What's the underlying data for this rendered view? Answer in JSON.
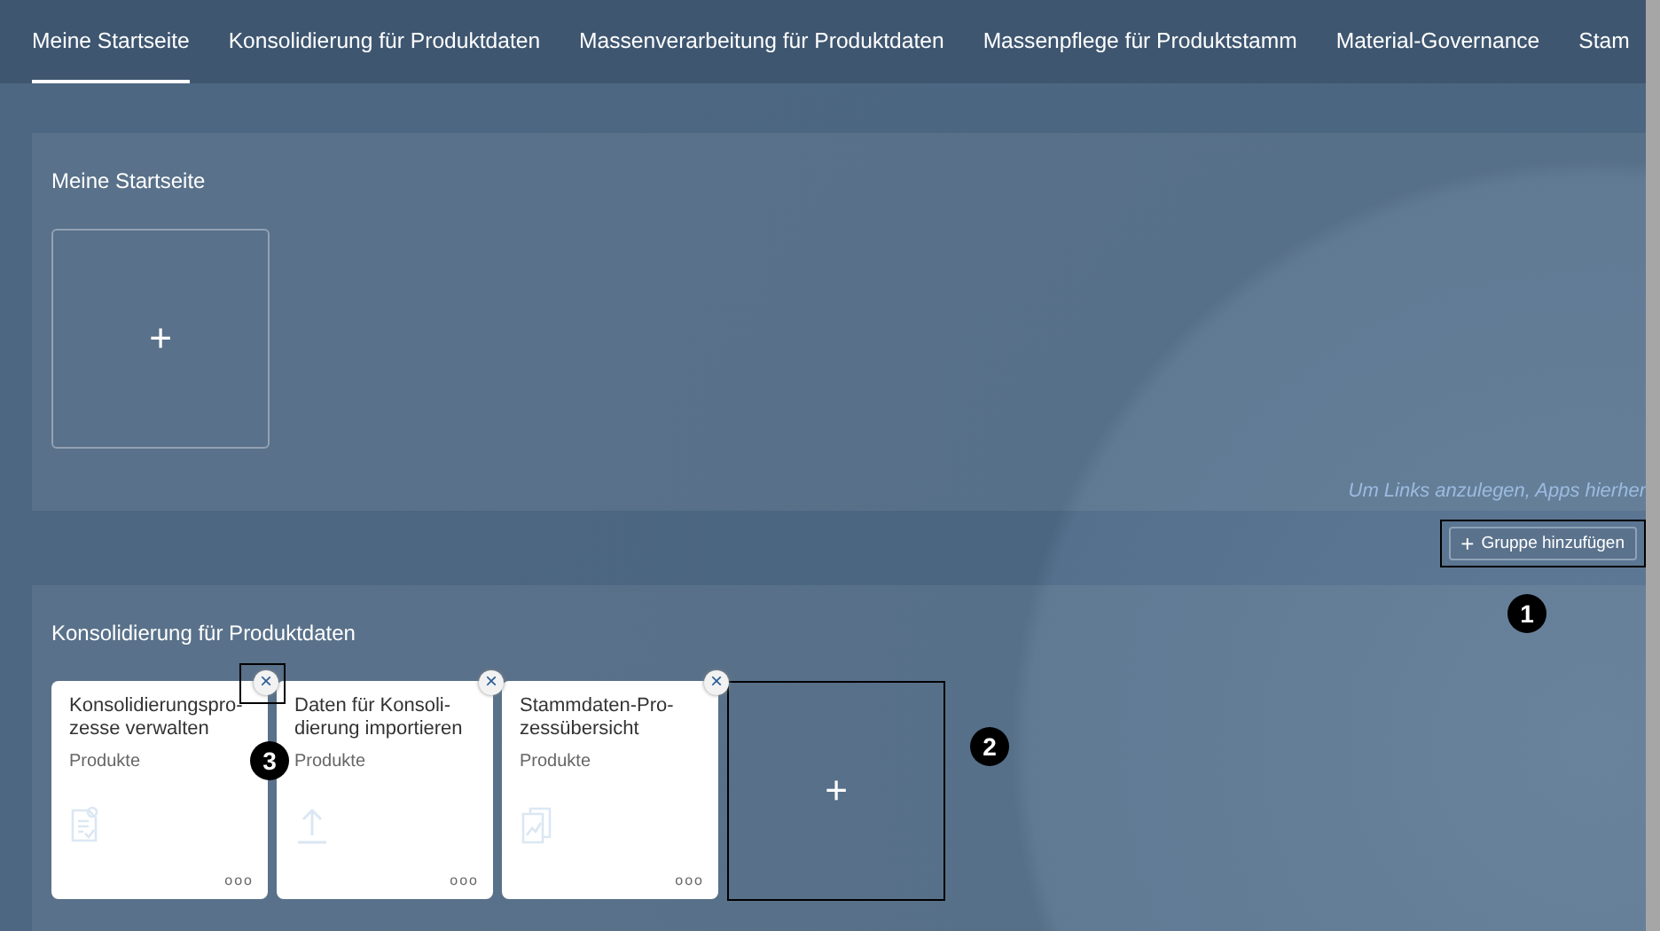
{
  "tabs": [
    {
      "label": "Meine Startseite",
      "selected": true
    },
    {
      "label": "Konsolidierung für Produktdaten",
      "selected": false
    },
    {
      "label": "Massenverarbeitung für Produktdaten",
      "selected": false
    },
    {
      "label": "Massenpflege für Produktstamm",
      "selected": false
    },
    {
      "label": "Material-Governance",
      "selected": false
    },
    {
      "label": "Stam",
      "selected": false
    }
  ],
  "groups": [
    {
      "title": "Meine Startseite",
      "add_tile": {
        "label": "+",
        "highlighted": false
      },
      "hint": "Um Links anzulegen, Apps hierher"
    },
    {
      "title": "Konsolidierung für Produktdaten",
      "tiles": [
        {
          "title": "Konsolidierungspro- zesse verwalten",
          "subtitle": "Produkte",
          "kind": "document",
          "more": "ooo",
          "close": "×"
        },
        {
          "title": "Daten für Konsoli- dierung importieren",
          "subtitle": "Produkte",
          "kind": "upload",
          "more": "ooo",
          "close": "×"
        },
        {
          "title": "Stammdaten-Pro- zessübersicht",
          "subtitle": "Produkte",
          "kind": "report",
          "more": "ooo",
          "close": "×"
        }
      ],
      "add_tile": {
        "label": "+",
        "highlighted": true
      }
    }
  ],
  "add_group_button": {
    "label": "Gruppe hinzufügen",
    "icon": "+"
  },
  "callouts": [
    {
      "label": "1"
    },
    {
      "label": "2"
    },
    {
      "label": "3"
    }
  ]
}
